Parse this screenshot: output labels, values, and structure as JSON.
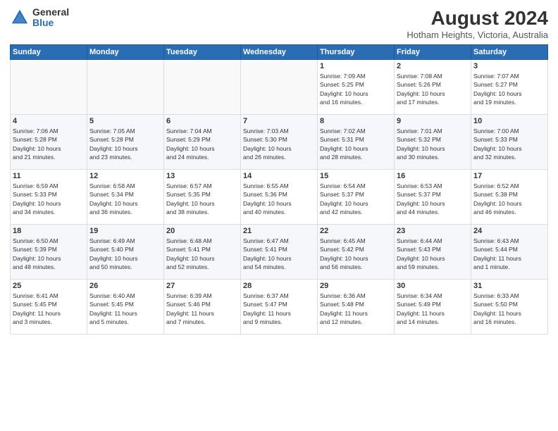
{
  "header": {
    "logo_general": "General",
    "logo_blue": "Blue",
    "month_year": "August 2024",
    "location": "Hotham Heights, Victoria, Australia"
  },
  "weekdays": [
    "Sunday",
    "Monday",
    "Tuesday",
    "Wednesday",
    "Thursday",
    "Friday",
    "Saturday"
  ],
  "weeks": [
    [
      {
        "day": "",
        "info": ""
      },
      {
        "day": "",
        "info": ""
      },
      {
        "day": "",
        "info": ""
      },
      {
        "day": "",
        "info": ""
      },
      {
        "day": "1",
        "info": "Sunrise: 7:09 AM\nSunset: 5:25 PM\nDaylight: 10 hours\nand 16 minutes."
      },
      {
        "day": "2",
        "info": "Sunrise: 7:08 AM\nSunset: 5:26 PM\nDaylight: 10 hours\nand 17 minutes."
      },
      {
        "day": "3",
        "info": "Sunrise: 7:07 AM\nSunset: 5:27 PM\nDaylight: 10 hours\nand 19 minutes."
      }
    ],
    [
      {
        "day": "4",
        "info": "Sunrise: 7:06 AM\nSunset: 5:28 PM\nDaylight: 10 hours\nand 21 minutes."
      },
      {
        "day": "5",
        "info": "Sunrise: 7:05 AM\nSunset: 5:28 PM\nDaylight: 10 hours\nand 23 minutes."
      },
      {
        "day": "6",
        "info": "Sunrise: 7:04 AM\nSunset: 5:29 PM\nDaylight: 10 hours\nand 24 minutes."
      },
      {
        "day": "7",
        "info": "Sunrise: 7:03 AM\nSunset: 5:30 PM\nDaylight: 10 hours\nand 26 minutes."
      },
      {
        "day": "8",
        "info": "Sunrise: 7:02 AM\nSunset: 5:31 PM\nDaylight: 10 hours\nand 28 minutes."
      },
      {
        "day": "9",
        "info": "Sunrise: 7:01 AM\nSunset: 5:32 PM\nDaylight: 10 hours\nand 30 minutes."
      },
      {
        "day": "10",
        "info": "Sunrise: 7:00 AM\nSunset: 5:33 PM\nDaylight: 10 hours\nand 32 minutes."
      }
    ],
    [
      {
        "day": "11",
        "info": "Sunrise: 6:59 AM\nSunset: 5:33 PM\nDaylight: 10 hours\nand 34 minutes."
      },
      {
        "day": "12",
        "info": "Sunrise: 6:58 AM\nSunset: 5:34 PM\nDaylight: 10 hours\nand 36 minutes."
      },
      {
        "day": "13",
        "info": "Sunrise: 6:57 AM\nSunset: 5:35 PM\nDaylight: 10 hours\nand 38 minutes."
      },
      {
        "day": "14",
        "info": "Sunrise: 6:55 AM\nSunset: 5:36 PM\nDaylight: 10 hours\nand 40 minutes."
      },
      {
        "day": "15",
        "info": "Sunrise: 6:54 AM\nSunset: 5:37 PM\nDaylight: 10 hours\nand 42 minutes."
      },
      {
        "day": "16",
        "info": "Sunrise: 6:53 AM\nSunset: 5:37 PM\nDaylight: 10 hours\nand 44 minutes."
      },
      {
        "day": "17",
        "info": "Sunrise: 6:52 AM\nSunset: 5:38 PM\nDaylight: 10 hours\nand 46 minutes."
      }
    ],
    [
      {
        "day": "18",
        "info": "Sunrise: 6:50 AM\nSunset: 5:39 PM\nDaylight: 10 hours\nand 48 minutes."
      },
      {
        "day": "19",
        "info": "Sunrise: 6:49 AM\nSunset: 5:40 PM\nDaylight: 10 hours\nand 50 minutes."
      },
      {
        "day": "20",
        "info": "Sunrise: 6:48 AM\nSunset: 5:41 PM\nDaylight: 10 hours\nand 52 minutes."
      },
      {
        "day": "21",
        "info": "Sunrise: 6:47 AM\nSunset: 5:41 PM\nDaylight: 10 hours\nand 54 minutes."
      },
      {
        "day": "22",
        "info": "Sunrise: 6:45 AM\nSunset: 5:42 PM\nDaylight: 10 hours\nand 56 minutes."
      },
      {
        "day": "23",
        "info": "Sunrise: 6:44 AM\nSunset: 5:43 PM\nDaylight: 10 hours\nand 59 minutes."
      },
      {
        "day": "24",
        "info": "Sunrise: 6:43 AM\nSunset: 5:44 PM\nDaylight: 11 hours\nand 1 minute."
      }
    ],
    [
      {
        "day": "25",
        "info": "Sunrise: 6:41 AM\nSunset: 5:45 PM\nDaylight: 11 hours\nand 3 minutes."
      },
      {
        "day": "26",
        "info": "Sunrise: 6:40 AM\nSunset: 5:45 PM\nDaylight: 11 hours\nand 5 minutes."
      },
      {
        "day": "27",
        "info": "Sunrise: 6:39 AM\nSunset: 5:46 PM\nDaylight: 11 hours\nand 7 minutes."
      },
      {
        "day": "28",
        "info": "Sunrise: 6:37 AM\nSunset: 5:47 PM\nDaylight: 11 hours\nand 9 minutes."
      },
      {
        "day": "29",
        "info": "Sunrise: 6:36 AM\nSunset: 5:48 PM\nDaylight: 11 hours\nand 12 minutes."
      },
      {
        "day": "30",
        "info": "Sunrise: 6:34 AM\nSunset: 5:49 PM\nDaylight: 11 hours\nand 14 minutes."
      },
      {
        "day": "31",
        "info": "Sunrise: 6:33 AM\nSunset: 5:50 PM\nDaylight: 11 hours\nand 16 minutes."
      }
    ]
  ]
}
